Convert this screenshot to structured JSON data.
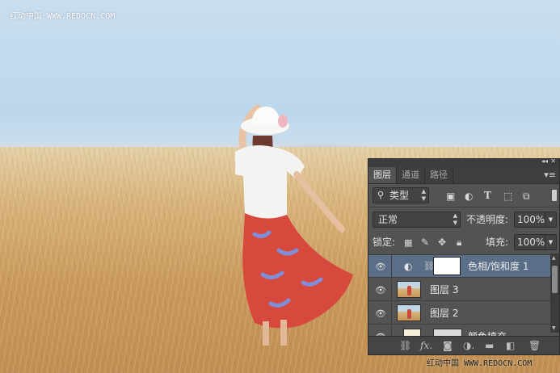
{
  "watermark": {
    "top": "红动中国 WWW.REDOCN.COM",
    "bottom": "红动中国 WWW.REDOCN.COM"
  },
  "panel": {
    "tabs": [
      "图层",
      "通道",
      "路径"
    ],
    "active_tab": "图层",
    "filter_kind": "类型",
    "blend_mode": "正常",
    "opacity_label": "不透明度:",
    "opacity_value": "100%",
    "lock_label": "锁定:",
    "fill_label": "填充:",
    "fill_value": "100%",
    "layers": [
      {
        "name": "色相/饱和度 1",
        "type": "adjustment",
        "selected": true
      },
      {
        "name": "图层 3",
        "type": "pixel",
        "selected": false
      },
      {
        "name": "图层 2",
        "type": "pixel",
        "selected": false
      },
      {
        "name": "颜色填充",
        "type": "fill",
        "selected": false
      }
    ],
    "footer_icons": [
      "link-icon",
      "fx-icon",
      "mask-icon",
      "adjustment-icon",
      "folder-icon",
      "new-layer-icon",
      "trash-icon"
    ]
  },
  "colors": {
    "panel_bg": "#535353",
    "selected_layer": "#5a6f87",
    "sky": "#bcd7ec",
    "field": "#d8b37a"
  }
}
